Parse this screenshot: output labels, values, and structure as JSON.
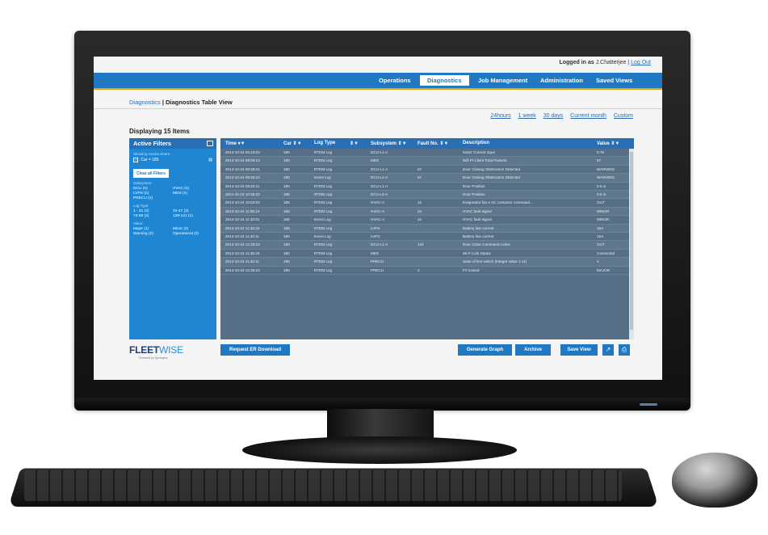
{
  "header": {
    "logged_in_label": "Logged in as",
    "user": "J.Chatterjee",
    "logout": "Log Out"
  },
  "nav": {
    "items": [
      {
        "label": "Operations",
        "active": false
      },
      {
        "label": "Diagnostics",
        "active": true
      },
      {
        "label": "Job Management",
        "active": false
      },
      {
        "label": "Administration",
        "active": false
      },
      {
        "label": "Saved Views",
        "active": false
      }
    ]
  },
  "breadcrumb": {
    "root": "Diagnostics",
    "separator": "|",
    "current": "Diagnostics Table View"
  },
  "time_ranges": [
    "24hours",
    "1 week",
    "30 days",
    "Current month",
    "Custom"
  ],
  "display_count": "Displaying 15 Items",
  "filters": {
    "title": "Active Filters",
    "showing_label": "Showing events where:",
    "chip": "Car = 185",
    "clear_label": "Clear all Filters",
    "groups": [
      {
        "label": "Subsystem:",
        "options": [
          "DCU (n)",
          "HVAC (n)",
          "LVPS (n)",
          "MDS (n)",
          "PRECU (n)"
        ]
      },
      {
        "label": "Log Type:",
        "options": [
          "1 - 31 (2)",
          "32-47 (3)",
          "73-89 (2)",
          "139-141 (1)"
        ]
      },
      {
        "label": "Value:",
        "options": [
          "Major (1)",
          "Minor (2)",
          "Warning (2)",
          "Operational (2)"
        ]
      }
    ]
  },
  "table": {
    "columns": [
      "Time",
      "Car",
      "Log Type",
      "Subsystem",
      "Fault No.",
      "Description",
      "Value"
    ],
    "rows": [
      [
        "2014-10-24 08:10:03",
        "185",
        "RTDM Log",
        "DCU-L1-A",
        "",
        "Motor Current Input",
        "0.76"
      ],
      [
        "2014-10-24 09:09:13",
        "185",
        "RTDM Log",
        "MDS",
        "",
        "Wifi Pi Client Total Packets",
        "67"
      ],
      [
        "2014-10-24 09:35:01",
        "185",
        "RTDM Log",
        "DCU-L1-A",
        "67",
        "Door Closing Obstruction Detected",
        "WARNING"
      ],
      [
        "2014-10-24 09:35:23",
        "185",
        "Event Log",
        "DCU-L1-A",
        "67",
        "Door Closing Obstruction Detected",
        "WARNING"
      ],
      [
        "2014-10-24 09:40:11",
        "185",
        "RTDM Log",
        "DCU-L1-A",
        "",
        "Door Position",
        "0.5 m"
      ],
      [
        "2014-10-24 10:35:23",
        "185",
        "RTDM Log",
        "DCU-L2-A",
        "",
        "Door Position",
        "0.5 m"
      ],
      [
        "2014-10-24 10:50:03",
        "185",
        "RTDM Log",
        "HVAC-A",
        "12",
        "Evaporator fan A AC contactor command...",
        "OUT"
      ],
      [
        "2014-10-24 11:05:13",
        "185",
        "RTDM Log",
        "HVAC-A",
        "24",
        "HVAC fault signal",
        "MINOR"
      ],
      [
        "2014-10-24 11:32:01",
        "185",
        "Event Log",
        "HVAC-A",
        "24",
        "HVAC fault signal",
        "MINOR"
      ],
      [
        "2014-10-24 11:35:23",
        "185",
        "RTDM Log",
        "LVPS",
        "",
        "Battery line current",
        "15A"
      ],
      [
        "2014-10-24 11:40:11",
        "185",
        "Event Log",
        "LVPS",
        "",
        "Battery line current",
        "15A"
      ],
      [
        "2014-10-24 12:35:23",
        "185",
        "RTDM Log",
        "DCU-L1-A",
        "134",
        "Door Close Command Active",
        "OUT"
      ],
      [
        "2014-10-24 11:35:23",
        "185",
        "RTDM Log",
        "MDS",
        "",
        "Wi-Fi Link Status",
        "Connected"
      ],
      [
        "2014-10-24 11:40:11",
        "185",
        "RTDM Log",
        "PRECU",
        "",
        "State of line switch (Integer value 1-11)",
        "4"
      ],
      [
        "2014-10-24 12:35:23",
        "185",
        "RTDM Log",
        "PRECU",
        "2",
        "FV locked",
        "MAJOR"
      ]
    ]
  },
  "footer": {
    "logo_fleet": "FLEET",
    "logo_wise": "WISE",
    "logo_sub": "Powered by Synergexx",
    "request_label": "Request ER Download",
    "generate_label": "Generate Graph",
    "archive_label": "Archive",
    "save_view_label": "Save View",
    "icons": [
      "external-link-icon",
      "print-icon"
    ]
  },
  "colors": {
    "nav": "#1f78c1",
    "accent": "#e8a200",
    "panel": "#1e86d2",
    "table_bg": "#566f86"
  }
}
